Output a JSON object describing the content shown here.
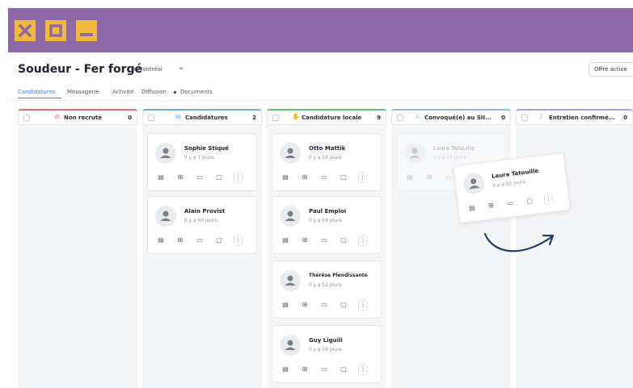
{
  "window": {
    "buttons": [
      {
        "name": "close-icon"
      },
      {
        "name": "maximize-icon"
      },
      {
        "name": "minimize-icon"
      }
    ],
    "accent": "#8e6aa8",
    "button_color": "#f2b93a"
  },
  "header": {
    "title": "Soudeur - Fer forgé",
    "location": "Montréal",
    "offer_button": "Offre active"
  },
  "tabs": [
    "Candidatures",
    "Messagerie",
    "Activité",
    "Diffusion",
    "Documents"
  ],
  "columns": [
    {
      "title": "Non recruté",
      "count": "0",
      "color": "#e86a6a",
      "icon": "ban-icon"
    },
    {
      "title": "Candidatures",
      "count": "2",
      "color": "#6aa9e8",
      "icon": "inbox-icon"
    },
    {
      "title": "Candidature locale",
      "count": "9",
      "color": "#5cc46a",
      "icon": "hand-icon"
    },
    {
      "title": "Convoqué(e) au SII...",
      "count": "0",
      "color": "#8fb8e8",
      "icon": "person-icon"
    },
    {
      "title": "Entretien confirmé...",
      "count": "0",
      "color": "#b49ae0",
      "icon": "mic-icon"
    }
  ],
  "cards": {
    "candidatures": [
      {
        "name": "Sophie Stiqué",
        "time": "Il y a 7 jours"
      },
      {
        "name": "Alain Provist",
        "time": "Il y a 60 jours"
      }
    ],
    "locale": [
      {
        "name": "Otto Mattik",
        "time": "Il y a 59 jours"
      },
      {
        "name": "Paul Emploi",
        "time": "Il y a 54 jours"
      },
      {
        "name": "Thérèse Plendissante",
        "time": "Il y a 52 jours"
      },
      {
        "name": "Guy Liguili",
        "time": "Il y a 58 jours"
      }
    ],
    "ghost": {
      "name": "Laura Tatouille",
      "time": "Il y a 52 jours"
    },
    "dragging": {
      "name": "Laura Tatouille",
      "time": "Il y a 52 jours"
    }
  }
}
